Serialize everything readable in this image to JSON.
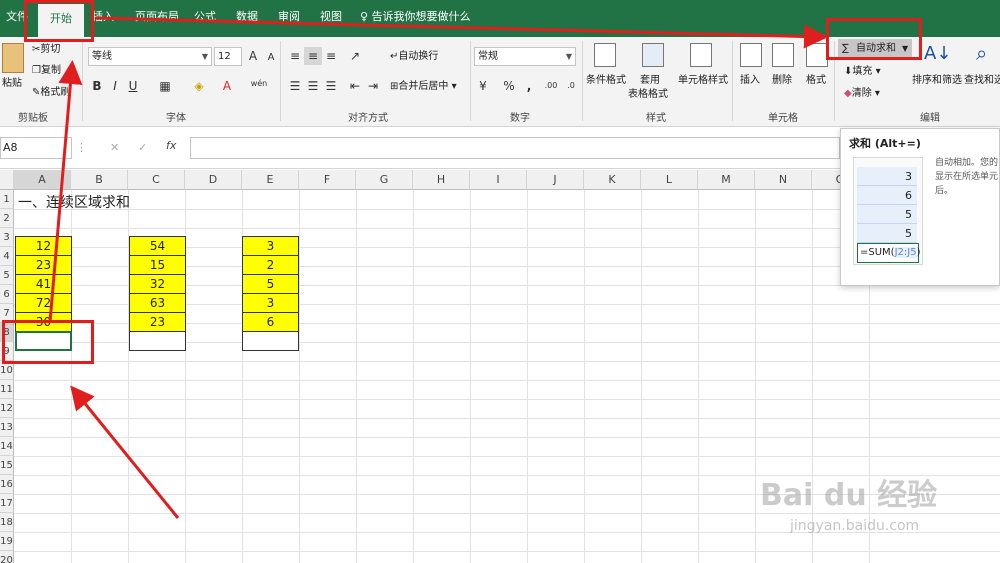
{
  "menu": {
    "tabs": [
      "文件",
      "开始",
      "插入",
      "页面布局",
      "公式",
      "数据",
      "审阅",
      "视图"
    ],
    "tell_me": "告诉我你想要做什么"
  },
  "ribbon": {
    "clipboard": {
      "paste": "粘贴",
      "cut": "剪切",
      "copy": "复制",
      "format_painter": "格式刷",
      "label": "剪贴板"
    },
    "font": {
      "name": "等线",
      "size": "12",
      "label": "字体",
      "bold": "B",
      "italic": "I",
      "underline": "U",
      "grow": "A",
      "shrink": "A",
      "font_color": "A",
      "wen": "wén"
    },
    "alignment": {
      "wrap": "自动换行",
      "merge": "合并后居中",
      "label": "对齐方式"
    },
    "number": {
      "format": "常规",
      "label": "数字",
      "percent": "%",
      "comma": ","
    },
    "styles": {
      "conditional": "条件格式",
      "table_format_1": "套用",
      "table_format_2": "表格格式",
      "cell_styles": "单元格样式",
      "label": "样式"
    },
    "cells": {
      "insert": "插入",
      "delete": "删除",
      "format": "格式",
      "label": "单元格"
    },
    "editing": {
      "autosum": "自动求和",
      "fill": "填充",
      "clear": "清除",
      "sort": "排序和筛选",
      "find": "查找和选",
      "label": "编辑"
    }
  },
  "formula_bar": {
    "name_box": "A8",
    "fx": "fx",
    "cancel": "✕",
    "confirm": "✓"
  },
  "sheet": {
    "columns": [
      "A",
      "B",
      "C",
      "D",
      "E",
      "F",
      "G",
      "H",
      "I",
      "J",
      "K",
      "L",
      "M",
      "N",
      "O"
    ],
    "rows": [
      "1",
      "2",
      "3",
      "4",
      "5",
      "6",
      "7",
      "8",
      "9",
      "10",
      "11",
      "12",
      "13",
      "14",
      "15",
      "16",
      "17",
      "18",
      "19",
      "20"
    ],
    "title": "一、连续区域求和",
    "col_a": [
      "12",
      "23",
      "41",
      "72",
      "30"
    ],
    "col_c": [
      "54",
      "15",
      "32",
      "63",
      "23"
    ],
    "col_e": [
      "3",
      "2",
      "5",
      "3",
      "6"
    ]
  },
  "tooltip": {
    "title": "求和 (Alt+=)",
    "cells": [
      "3",
      "6",
      "5",
      "5"
    ],
    "formula_prefix": "=SUM(",
    "formula_ref": "J2:J5",
    "formula_suffix": ")",
    "desc_1": "自动相加。您的",
    "desc_2": "显示在所选单元",
    "desc_3": "后。"
  },
  "watermark": {
    "text": "Bai du 经验",
    "url": "jingyan.baidu.com"
  },
  "colors": {
    "brand_green": "#217346",
    "highlight": "#ffff00",
    "annotation_red": "#e01e1e"
  }
}
